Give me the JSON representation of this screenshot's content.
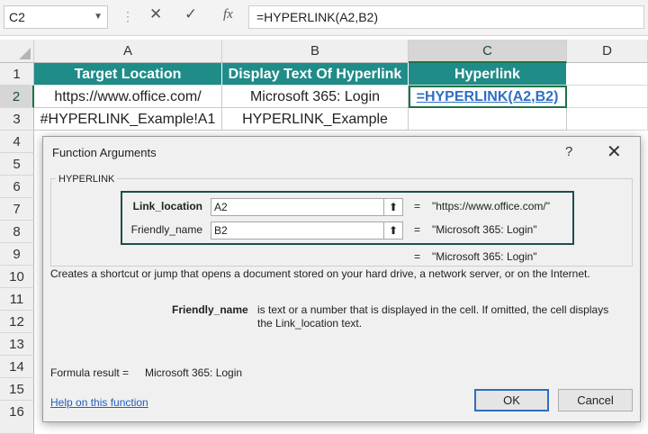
{
  "formula_bar": {
    "name_box": "C2",
    "cancel_icon": "✕",
    "enter_icon": "✓",
    "fx_label": "fx",
    "formula": "=HYPERLINK(A2,B2)"
  },
  "grid": {
    "columns": [
      "A",
      "B",
      "C",
      "D"
    ],
    "rows": [
      "1",
      "2",
      "3",
      "4",
      "5",
      "6",
      "7",
      "8",
      "9",
      "10",
      "11",
      "12",
      "13",
      "14",
      "15",
      "16"
    ],
    "header_row": [
      "Target Location",
      "Display Text Of Hyperlink",
      "Hyperlink"
    ],
    "row2": [
      "https://www.office.com/",
      "Microsoft 365: Login",
      "=HYPERLINK(A2,B2)"
    ],
    "row3": [
      "#HYPERLINK_Example!A1",
      "HYPERLINK_Example",
      ""
    ]
  },
  "dialog": {
    "title": "Function Arguments",
    "help_icon": "?",
    "close_icon": "✕",
    "function_name": "HYPERLINK",
    "args": [
      {
        "label": "Link_location",
        "value": "A2",
        "evaluated": "\"https://www.office.com/\""
      },
      {
        "label": "Friendly_name",
        "value": "B2",
        "evaluated": "\"Microsoft 365: Login\""
      }
    ],
    "equals": "=",
    "result_value": "\"Microsoft 365: Login\"",
    "description": "Creates a shortcut or jump that opens a document stored on your hard drive, a network server, or on the Internet.",
    "arg_desc_name": "Friendly_name",
    "arg_desc_text": "is text or a number that is displayed in the cell. If omitted, the cell displays the Link_location text.",
    "formula_result_label": "Formula result =",
    "formula_result_value": "Microsoft 365: Login",
    "help_link": "Help on this function",
    "ok_label": "OK",
    "cancel_label": "Cancel"
  }
}
